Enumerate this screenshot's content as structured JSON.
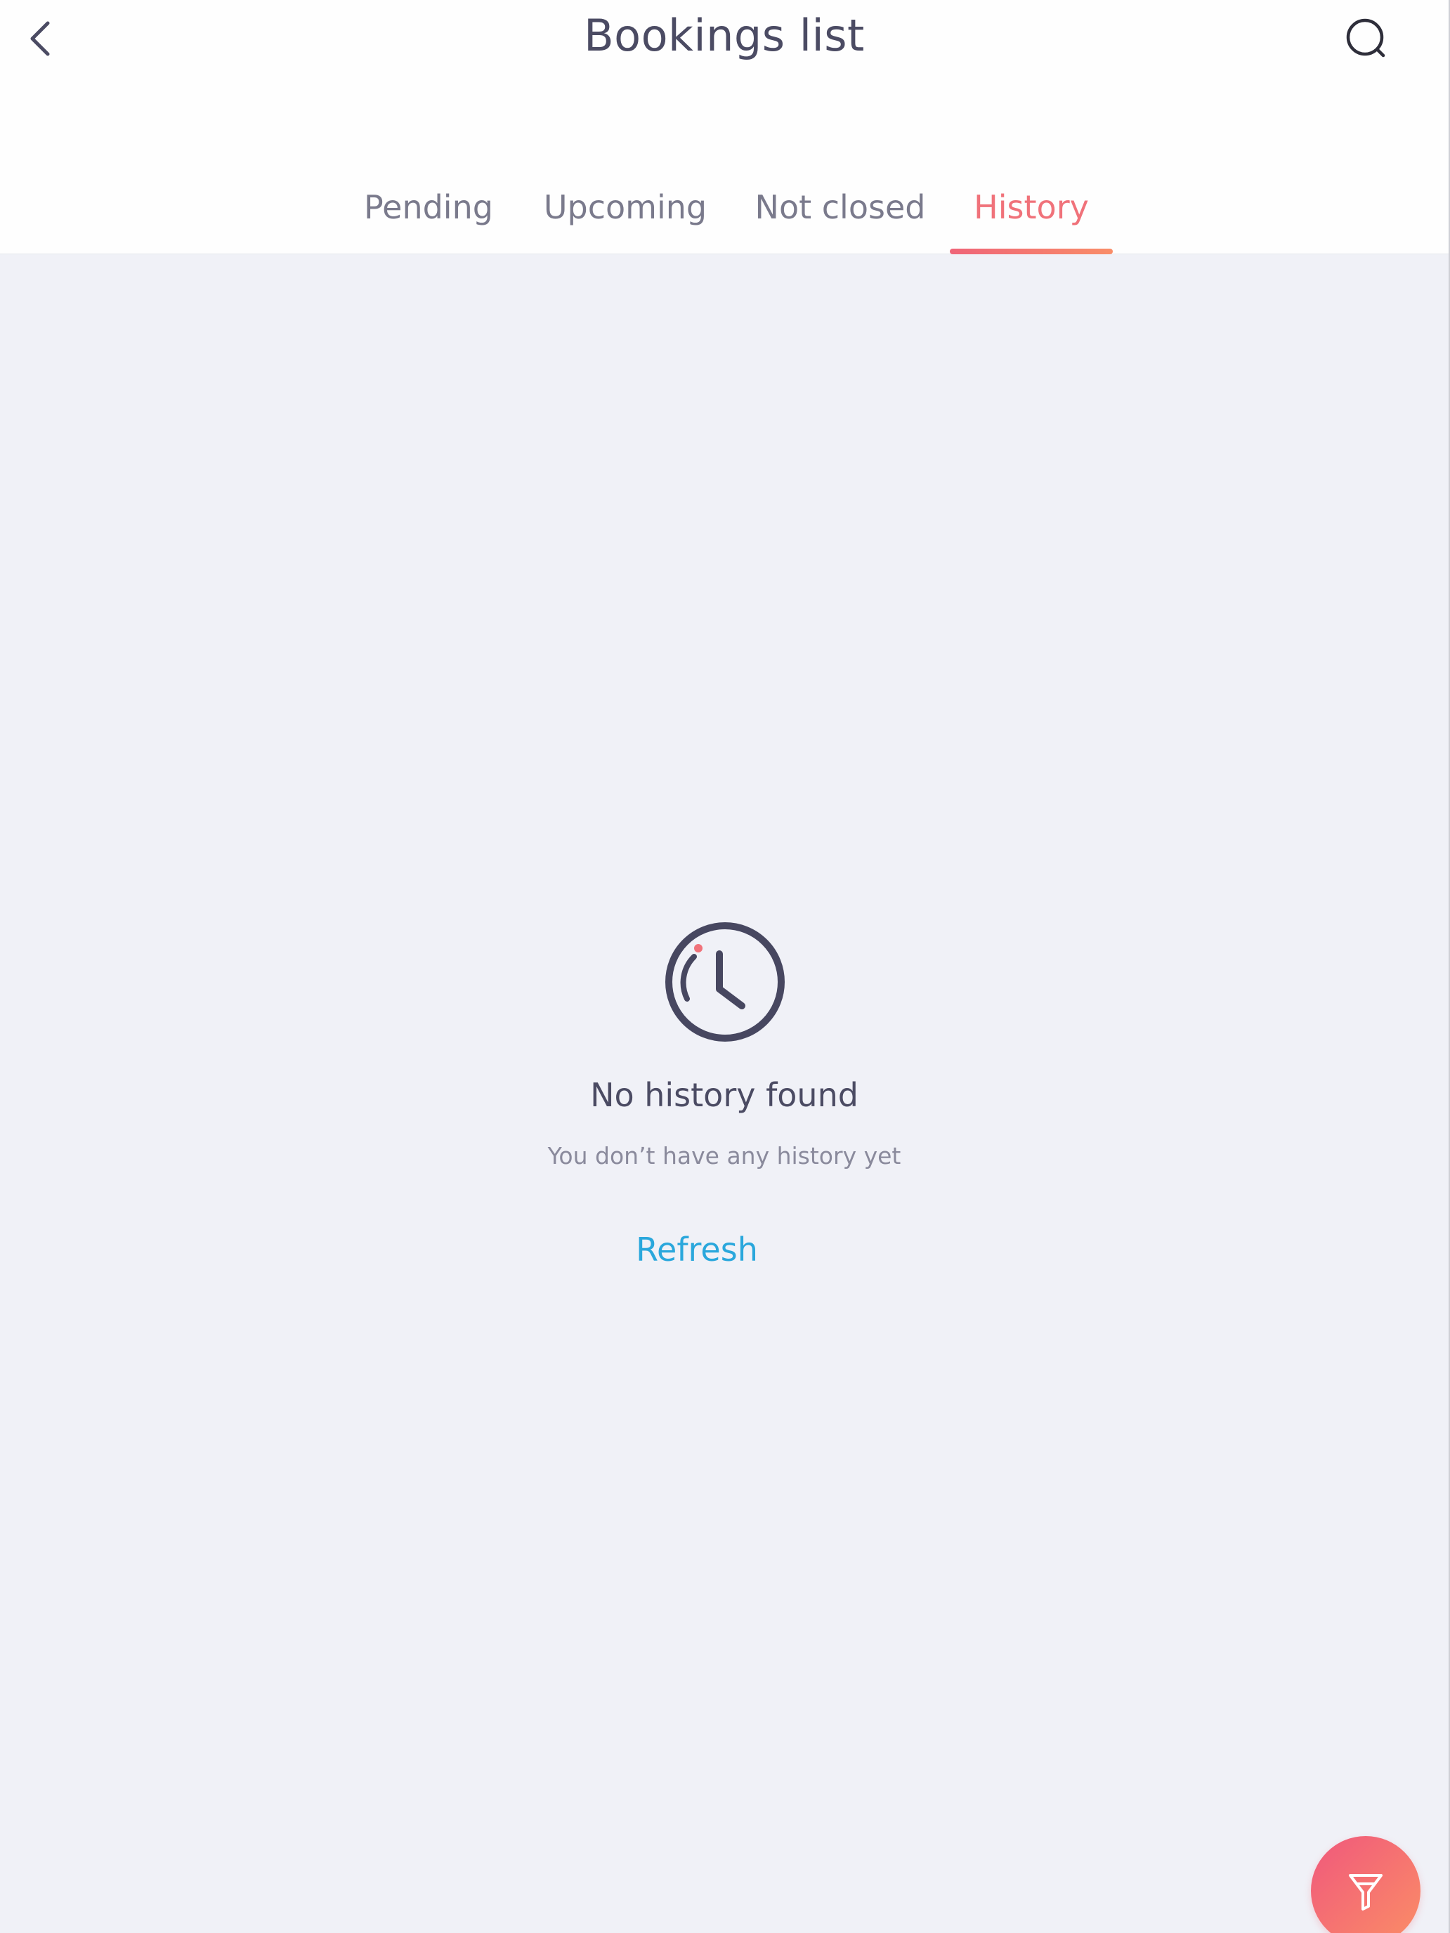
{
  "header": {
    "title": "Bookings list",
    "back_icon": "chevron-left-icon",
    "search_icon": "search-icon"
  },
  "tabs": [
    {
      "label": "Pending",
      "active": false
    },
    {
      "label": "Upcoming",
      "active": false
    },
    {
      "label": "Not closed",
      "active": false
    },
    {
      "label": "History",
      "active": true
    }
  ],
  "empty_state": {
    "icon": "clock-icon",
    "title": "No history found",
    "subtitle": "You don’t have any history yet",
    "refresh_label": "Refresh"
  },
  "fab": {
    "icon": "filter-icon"
  },
  "colors": {
    "accent": "#f0727a",
    "link": "#2aa7dc",
    "text_primary": "#4b4b63",
    "text_secondary": "#8a8a9c",
    "background": "#f0f1f7"
  }
}
